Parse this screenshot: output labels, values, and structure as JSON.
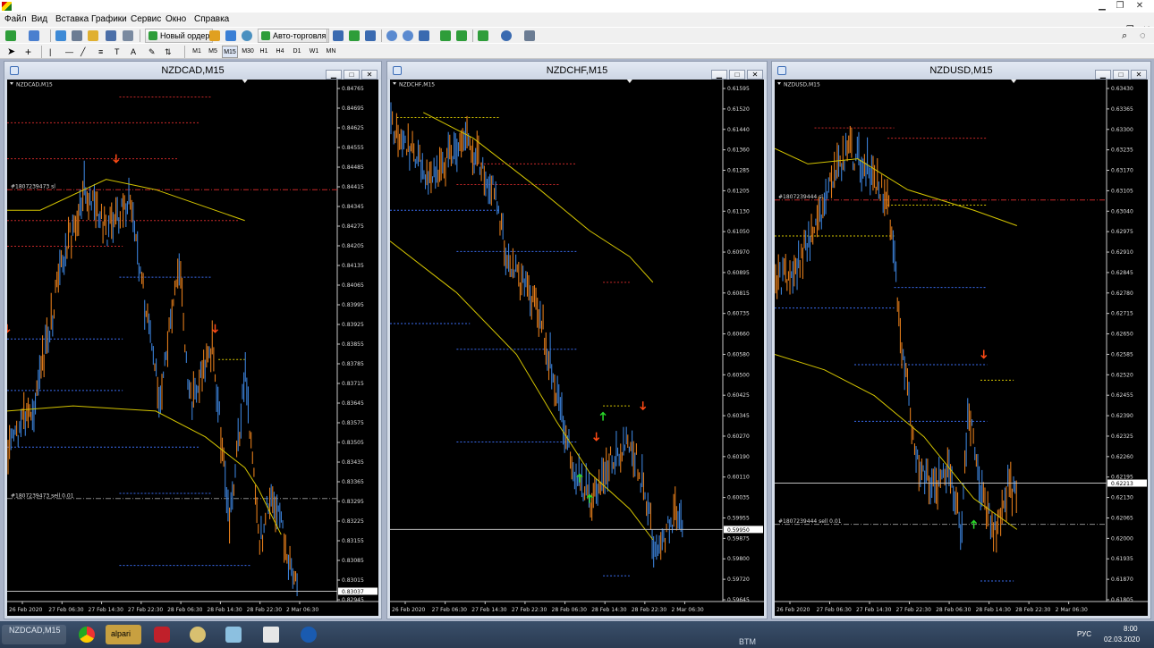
{
  "colors": {
    "up": "#3a7fd5",
    "down": "#e07b1a",
    "ma": "#d4c400",
    "grid_red": "#c62828",
    "grid_blue": "#3a6cf0",
    "grid_yellow": "#d4c400",
    "order_line": "#c0c0c0",
    "arrow_sell": "#ff4a14",
    "arrow_buy": "#2ad92a"
  },
  "menu": [
    "Файл",
    "Вид",
    "Вставка",
    "Графики",
    "Сервис",
    "Окно",
    "Справка"
  ],
  "toolbar": {
    "new_order": "Новый ордер",
    "autotrading": "Авто-торговля",
    "timeframes": [
      "M1",
      "M5",
      "M15",
      "M30",
      "H1",
      "H4",
      "D1",
      "W1",
      "MN"
    ],
    "selected_tf": "M15"
  },
  "charts": [
    {
      "window_title": "NZDCAD,M15",
      "symbol_label": "NZDCAD,M15",
      "y_ticks": [
        "0.84765",
        "0.84695",
        "0.84625",
        "0.84555",
        "0.84485",
        "0.84415",
        "0.84345",
        "0.84275",
        "0.84205",
        "0.84135",
        "0.84065",
        "0.83995",
        "0.83925",
        "0.83855",
        "0.83785",
        "0.83715",
        "0.83645",
        "0.83575",
        "0.83505",
        "0.83435",
        "0.83365",
        "0.83295",
        "0.83225",
        "0.83155",
        "0.83085",
        "0.83015",
        "0.82945"
      ],
      "x_ticks": [
        "26 Feb 2020",
        "27 Feb 06:30",
        "27 Feb 14:30",
        "27 Feb 22:30",
        "28 Feb 06:30",
        "28 Feb 14:30",
        "28 Feb 22:30",
        "2 Mar 06:30"
      ],
      "current_price": "0.83037",
      "order_labels": [
        {
          "text": "#1807239473 sl"
        },
        {
          "text": "#1807239473 sell 0.01"
        }
      ]
    },
    {
      "window_title": "NZDCHF,M15",
      "symbol_label": "NZDCHF,M15",
      "y_ticks": [
        "0.61595",
        "0.61520",
        "0.61440",
        "0.61360",
        "0.61285",
        "0.61205",
        "0.61130",
        "0.61050",
        "0.60970",
        "0.60895",
        "0.60815",
        "0.60735",
        "0.60660",
        "0.60580",
        "0.60500",
        "0.60425",
        "0.60345",
        "0.60270",
        "0.60190",
        "0.60110",
        "0.60035",
        "0.59955",
        "0.59875",
        "0.59800",
        "0.59720",
        "0.59645"
      ],
      "x_ticks": [
        "26 Feb 2020",
        "27 Feb 06:30",
        "27 Feb 14:30",
        "27 Feb 22:30",
        "28 Feb 06:30",
        "28 Feb 14:30",
        "28 Feb 22:30",
        "2 Mar 06:30"
      ],
      "current_price": "0.59950",
      "order_labels": []
    },
    {
      "window_title": "NZDUSD,M15",
      "symbol_label": "NZDUSD,M15",
      "y_ticks": [
        "0.63430",
        "0.63365",
        "0.63300",
        "0.63235",
        "0.63170",
        "0.63105",
        "0.63040",
        "0.62975",
        "0.62910",
        "0.62845",
        "0.62780",
        "0.62715",
        "0.62650",
        "0.62585",
        "0.62520",
        "0.62455",
        "0.62390",
        "0.62325",
        "0.62260",
        "0.62195",
        "0.62130",
        "0.62065",
        "0.62000",
        "0.61935",
        "0.61870",
        "0.61805"
      ],
      "x_ticks": [
        "26 Feb 2020",
        "27 Feb 06:30",
        "27 Feb 14:30",
        "27 Feb 22:30",
        "28 Feb 06:30",
        "28 Feb 14:30",
        "28 Feb 22:30",
        "2 Mar 06:30"
      ],
      "current_price": "0.62213",
      "order_labels": [
        {
          "text": "#1807239444 sl"
        },
        {
          "text": "#1807239444 sell 0.01"
        }
      ]
    }
  ],
  "taskbar": {
    "items": [
      "NZDCAD,M15",
      "alpari",
      "BTM"
    ],
    "tray": {
      "lang": "РУС",
      "time": "8:00",
      "date": "02.03.2020"
    }
  }
}
